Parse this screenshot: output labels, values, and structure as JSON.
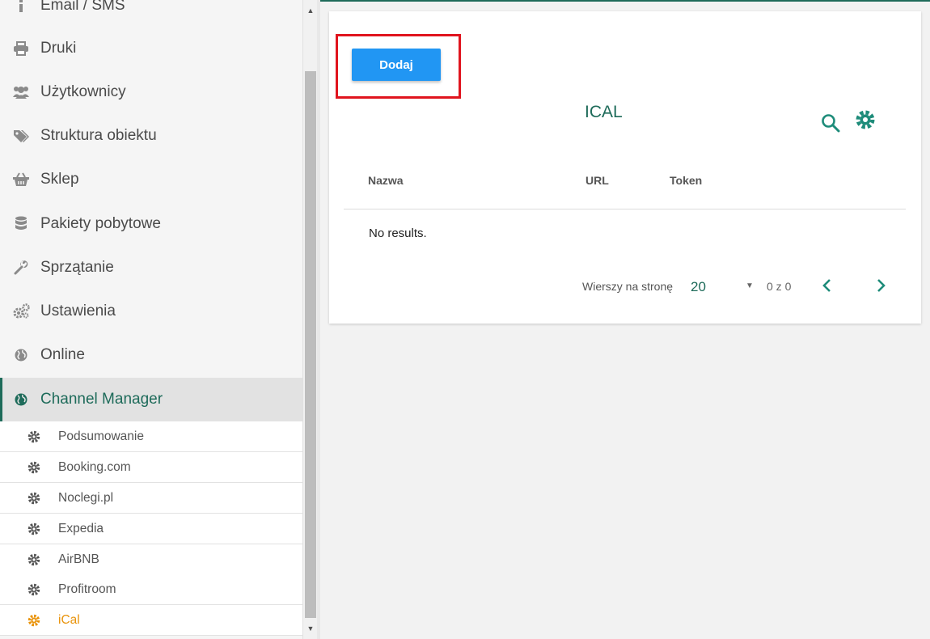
{
  "sidebar": {
    "items": [
      {
        "label": "Email / SMS",
        "icon": "info-icon"
      },
      {
        "label": "Druki",
        "icon": "printer-icon"
      },
      {
        "label": "Użytkownicy",
        "icon": "users-icon"
      },
      {
        "label": "Struktura obiektu",
        "icon": "tags-icon"
      },
      {
        "label": "Sklep",
        "icon": "basket-icon"
      },
      {
        "label": "Pakiety pobytowe",
        "icon": "database-icon"
      },
      {
        "label": "Sprzątanie",
        "icon": "wrench-icon"
      },
      {
        "label": "Ustawienia",
        "icon": "cogs-icon"
      },
      {
        "label": "Online",
        "icon": "globe-icon"
      },
      {
        "label": "Channel Manager",
        "icon": "globe-icon",
        "active": true
      }
    ],
    "subitems": [
      {
        "label": "Podsumowanie",
        "icon": "gear-icon"
      },
      {
        "label": "Booking.com",
        "icon": "gear-icon"
      },
      {
        "label": "Noclegi.pl",
        "icon": "gear-icon"
      },
      {
        "label": "Expedia",
        "icon": "gear-icon"
      },
      {
        "label": "AirBNB",
        "icon": "gear-icon"
      },
      {
        "label": "Profitroom",
        "icon": "gear-icon"
      },
      {
        "label": "iCal",
        "icon": "gear-icon",
        "active": true
      }
    ]
  },
  "main": {
    "add_button_label": "Dodaj",
    "title": "ICAL",
    "columns": [
      "Nazwa",
      "URL",
      "Token"
    ],
    "empty_text": "No results.",
    "pagination": {
      "rows_per_page_label": "Wierszy na stronę",
      "rows_per_page_value": "20",
      "page_info": "0 z 0"
    }
  },
  "colors": {
    "accent": "#1e6b5a",
    "button": "#2196f3",
    "active_subitem": "#e9930a",
    "highlight": "#e0141e"
  }
}
